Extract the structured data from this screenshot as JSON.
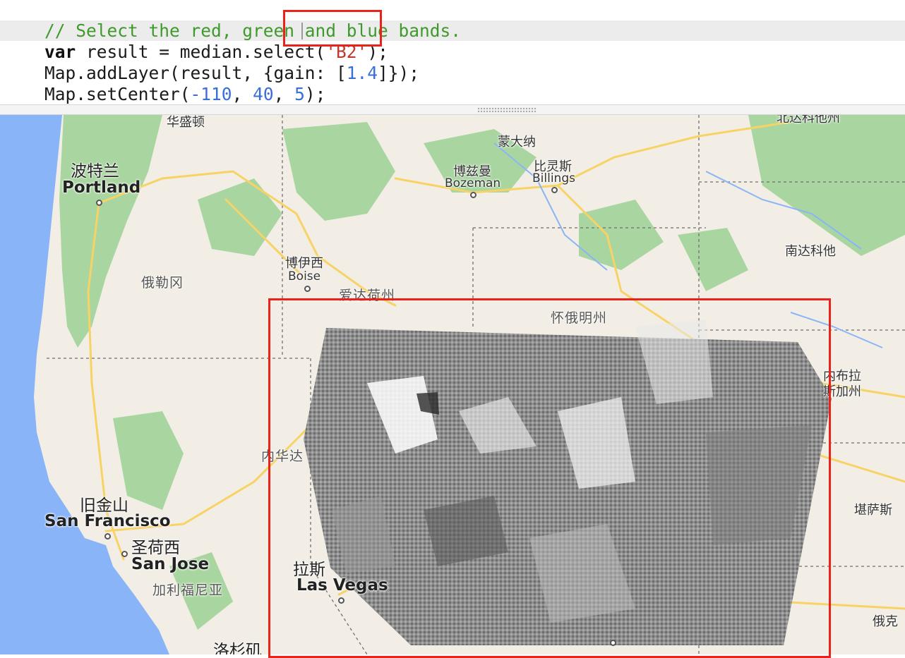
{
  "editor": {
    "line1": {
      "comment": "// Select the red, green and blue bands."
    },
    "line2": {
      "kw": "var",
      "a": " result = median.select(",
      "str": "'B2'",
      "b": ");"
    },
    "line3": {
      "a": "Map.addLayer(result, {gain: [",
      "num": "1.4",
      "b": "]});"
    },
    "line4": {
      "a": "Map.setCenter(",
      "n1": "-110",
      "s1": ", ",
      "n2": "40",
      "s2": ", ",
      "n3": "5",
      "b": ");"
    }
  },
  "map": {
    "labels": {
      "washington": "华盛顿",
      "montana": "蒙大纳",
      "north_dakota": "北达科他州",
      "portland_cn": "波特兰",
      "portland_en": "Portland",
      "bozeman_cn": "博兹曼",
      "bozeman_en": "Bozeman",
      "billings_cn": "比灵斯",
      "billings_en": "Billings",
      "south_dakota": "南达科他",
      "boise_cn": "博伊西",
      "boise_en": "Boise",
      "oregon": "俄勒冈",
      "idaho": "爱达荷州",
      "wyoming": "怀俄明州",
      "nebraska_line1": "内布拉",
      "nebraska_line2": "斯加州",
      "nevada": "内华达",
      "kansas": "堪萨斯",
      "sf_cn": "旧金山",
      "sf_en": "San Francisco",
      "sj_cn": "圣荷西",
      "sj_en": "San Jose",
      "california": "加利福尼亚",
      "lv_cn": "拉斯",
      "lv_en": "Las Vegas",
      "la_cn": "洛杉矶",
      "oklahoma": "俄克"
    },
    "colors": {
      "ocean": "#8ab4f8",
      "land": "#f2eee6",
      "forest": "#a9d6a0",
      "highway": "#f7d366",
      "border": "#6f6f6f",
      "annotation": "#e8231b"
    }
  }
}
